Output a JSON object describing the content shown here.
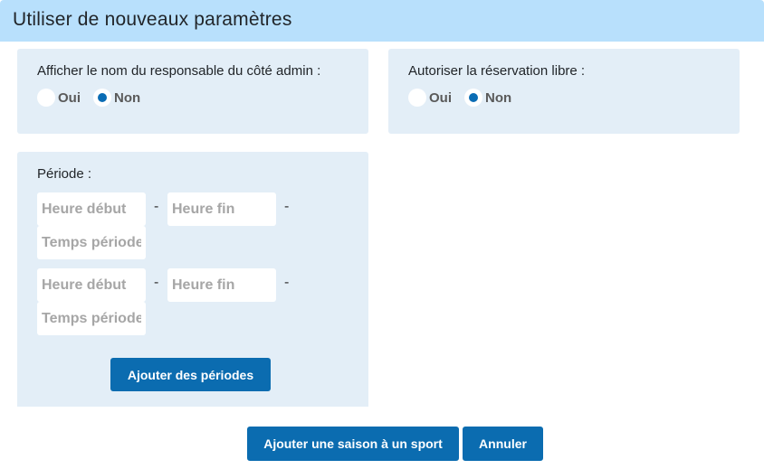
{
  "dialog": {
    "title": "Utiliser de nouveaux paramètres"
  },
  "admin_panel": {
    "label": "Afficher le nom du responsable du côté admin :",
    "options": [
      {
        "label": "Oui",
        "checked": false
      },
      {
        "label": "Non",
        "checked": true
      }
    ]
  },
  "free_booking_panel": {
    "label": "Autoriser la réservation libre :",
    "options": [
      {
        "label": "Oui",
        "checked": false
      },
      {
        "label": "Non",
        "checked": true
      }
    ]
  },
  "period_panel": {
    "label": "Période :",
    "separator": "-",
    "rows": [
      {
        "start_placeholder": "Heure début",
        "end_placeholder": "Heure fin",
        "duration_placeholder": "Temps période"
      },
      {
        "start_placeholder": "Heure début",
        "end_placeholder": "Heure fin",
        "duration_placeholder": "Temps période"
      }
    ],
    "add_button": "Ajouter des périodes"
  },
  "footer": {
    "submit_button": "Ajouter une saison à un sport",
    "cancel_button": "Annuler"
  },
  "colors": {
    "header": "#b8e0fc",
    "panel": "#e3eef7",
    "primary": "#0b6cb0"
  }
}
